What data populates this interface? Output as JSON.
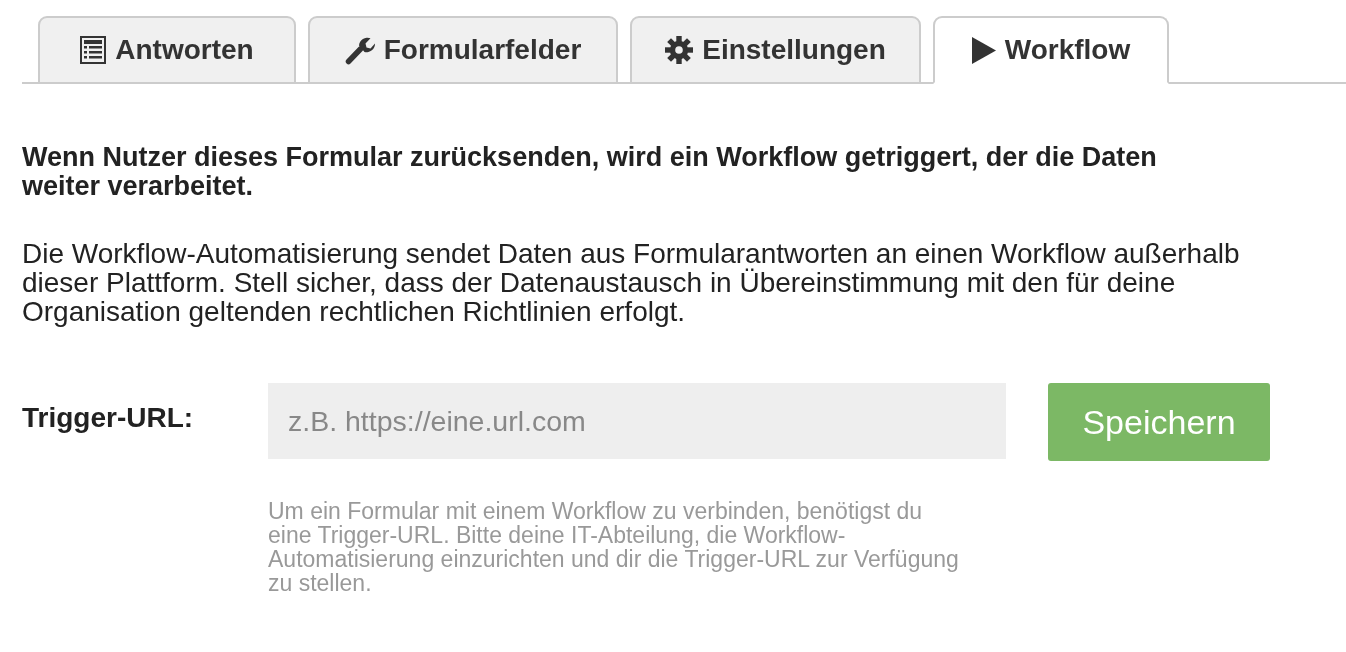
{
  "tabs": [
    {
      "label": "Antworten",
      "selected": false
    },
    {
      "label": "Formularfelder",
      "selected": false
    },
    {
      "label": "Einstellungen",
      "selected": false
    },
    {
      "label": "Workflow",
      "selected": true
    }
  ],
  "heading": "Wenn Nutzer dieses Formular zurücksenden, wird ein Workflow getriggert, der die Daten weiter verarbeitet.",
  "description": "Die Workflow-Automatisierung sendet Daten aus Formularantworten an einen Workflow außerhalb dieser Plattform. Stell sicher, dass der Datenaustausch in Übereinstimmung mit den für deine Organisation geltenden rechtlichen Richtlinien erfolgt.",
  "trigger_url": {
    "label": "Trigger-URL:",
    "placeholder": "z.B. https://eine.url.com",
    "help": "Um ein Formular mit einem Workflow zu verbinden, benötigst du eine Trigger-URL. Bitte deine IT-Abteilung, die Workflow-Automatisierung einzurichten und dir die Trigger-URL zur Verfügung zu stellen."
  },
  "save_button": "Speichern"
}
